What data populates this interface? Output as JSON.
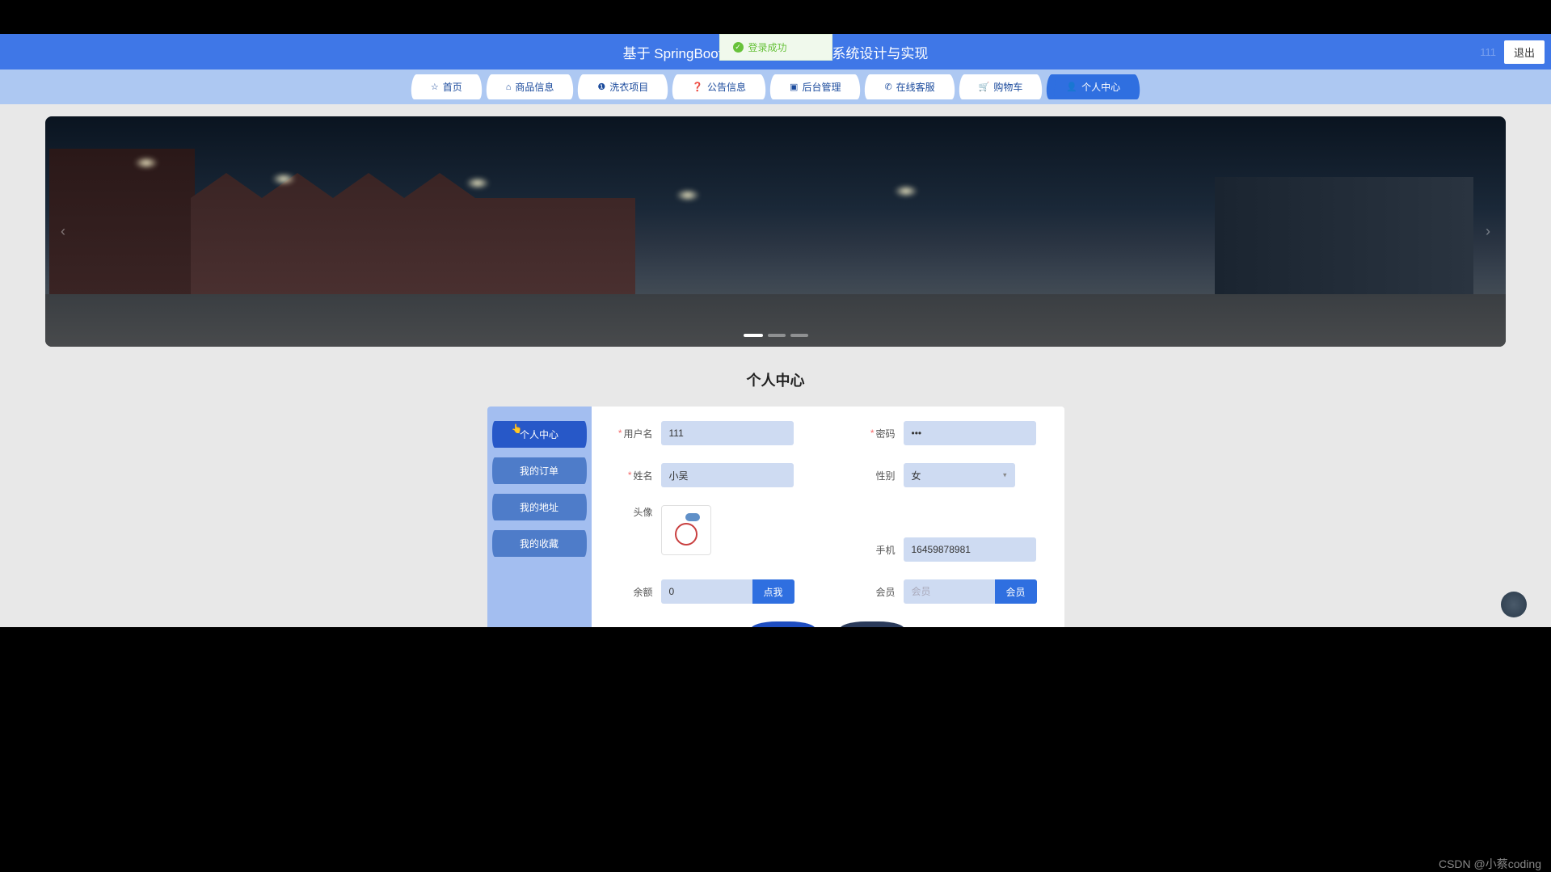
{
  "header": {
    "title": "基于 SpringBoot的干洗店预约洗衣系统设计与实现",
    "logout": "退出",
    "user_hint": "111"
  },
  "toast": {
    "text": "登录成功"
  },
  "nav": {
    "items": [
      {
        "icon": "☆",
        "label": "首页",
        "name": "nav-home"
      },
      {
        "icon": "⌂",
        "label": "商品信息",
        "name": "nav-products"
      },
      {
        "icon": "❶",
        "label": "洗衣项目",
        "name": "nav-laundry"
      },
      {
        "icon": "❓",
        "label": "公告信息",
        "name": "nav-notice"
      },
      {
        "icon": "▣",
        "label": "后台管理",
        "name": "nav-admin"
      },
      {
        "icon": "✆",
        "label": "在线客服",
        "name": "nav-service"
      },
      {
        "icon": "🛒",
        "label": "购物车",
        "name": "nav-cart"
      },
      {
        "icon": "👤",
        "label": "个人中心",
        "name": "nav-profile",
        "active": true
      }
    ]
  },
  "page": {
    "title": "个人中心"
  },
  "side_menu": {
    "items": [
      {
        "label": "个人中心",
        "name": "side-profile",
        "active": true
      },
      {
        "label": "我的订单",
        "name": "side-orders"
      },
      {
        "label": "我的地址",
        "name": "side-address"
      },
      {
        "label": "我的收藏",
        "name": "side-favorites"
      }
    ]
  },
  "form": {
    "username": {
      "label": "用户名",
      "value": "111",
      "required": true
    },
    "password": {
      "label": "密码",
      "value": "•••",
      "required": true
    },
    "realname": {
      "label": "姓名",
      "value": "小吴",
      "required": true
    },
    "gender": {
      "label": "性别",
      "value": "女"
    },
    "avatar": {
      "label": "头像"
    },
    "phone": {
      "label": "手机",
      "value": "16459878981"
    },
    "balance": {
      "label": "余额",
      "value": "0",
      "button": "点我"
    },
    "member": {
      "label": "会员",
      "placeholder": "会员",
      "button": "会员"
    }
  },
  "watermark": "CSDN @小蔡coding"
}
